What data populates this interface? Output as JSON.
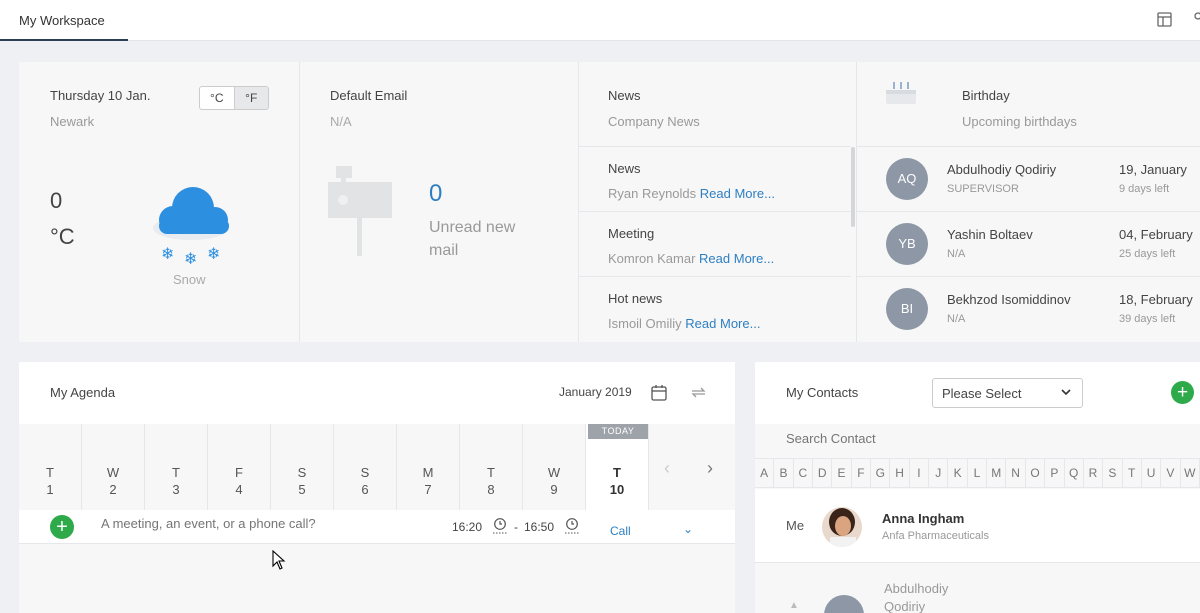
{
  "topbar": {
    "tab_label": "My Workspace"
  },
  "weather": {
    "date": "Thursday 10 Jan.",
    "city": "Newark",
    "unit_c": "°C",
    "unit_f": "°F",
    "temp": "0",
    "temp_unit": "°C",
    "condition": "Snow",
    "icon": "snow-cloud-icon"
  },
  "email": {
    "title": "Default Email",
    "address": "N/A",
    "count": "0",
    "label": "Unread new mail"
  },
  "news": {
    "title": "News",
    "subtitle": "Company News",
    "items": [
      {
        "heading": "News",
        "author": "Ryan Reynolds",
        "link": "Read More..."
      },
      {
        "heading": "Meeting",
        "author": "Komron Kamar",
        "link": "Read More..."
      },
      {
        "heading": "Hot news",
        "author": "Ismoil Omiliy",
        "link": "Read More..."
      }
    ]
  },
  "birthday": {
    "title": "Birthday",
    "subtitle": "Upcoming birthdays",
    "people": [
      {
        "initials": "AQ",
        "name": "Abdulhodiy Qodiriy",
        "role": "SUPERVISOR",
        "date": "19, January",
        "left": "9 days left"
      },
      {
        "initials": "YB",
        "name": "Yashin Boltaev",
        "role": "N/A",
        "date": "04, February",
        "left": "25 days left"
      },
      {
        "initials": "BI",
        "name": "Bekhzod Isomiddinov",
        "role": "N/A",
        "date": "18, February",
        "left": "39 days left"
      }
    ]
  },
  "agenda": {
    "title": "My Agenda",
    "month": "January 2019",
    "today_badge": "TODAY",
    "days": [
      {
        "name": "T",
        "num": "1"
      },
      {
        "name": "W",
        "num": "2"
      },
      {
        "name": "T",
        "num": "3"
      },
      {
        "name": "F",
        "num": "4"
      },
      {
        "name": "S",
        "num": "5"
      },
      {
        "name": "S",
        "num": "6"
      },
      {
        "name": "M",
        "num": "7"
      },
      {
        "name": "T",
        "num": "8"
      },
      {
        "name": "W",
        "num": "9"
      },
      {
        "name": "T",
        "num": "10"
      }
    ],
    "placeholder": "A meeting, an event, or a phone call?",
    "time_start": "16:20",
    "time_end": "16:50",
    "type": "Call"
  },
  "contacts": {
    "title": "My Contacts",
    "select": "Please Select",
    "search_placeholder": "Search Contact",
    "letters": [
      "A",
      "B",
      "C",
      "D",
      "E",
      "F",
      "G",
      "H",
      "I",
      "J",
      "K",
      "L",
      "M",
      "N",
      "O",
      "P",
      "Q",
      "R",
      "S",
      "T",
      "U",
      "V",
      "W"
    ],
    "me_label": "Me",
    "me_name": "Anna Ingham",
    "me_company": "Anfa Pharmaceuticals",
    "next_name": "Abdulhodiy Qodiriy"
  },
  "colors": {
    "accent_blue": "#2d7fc1",
    "add_green": "#2eaa4a",
    "avatar_gray": "#8d97a5"
  }
}
